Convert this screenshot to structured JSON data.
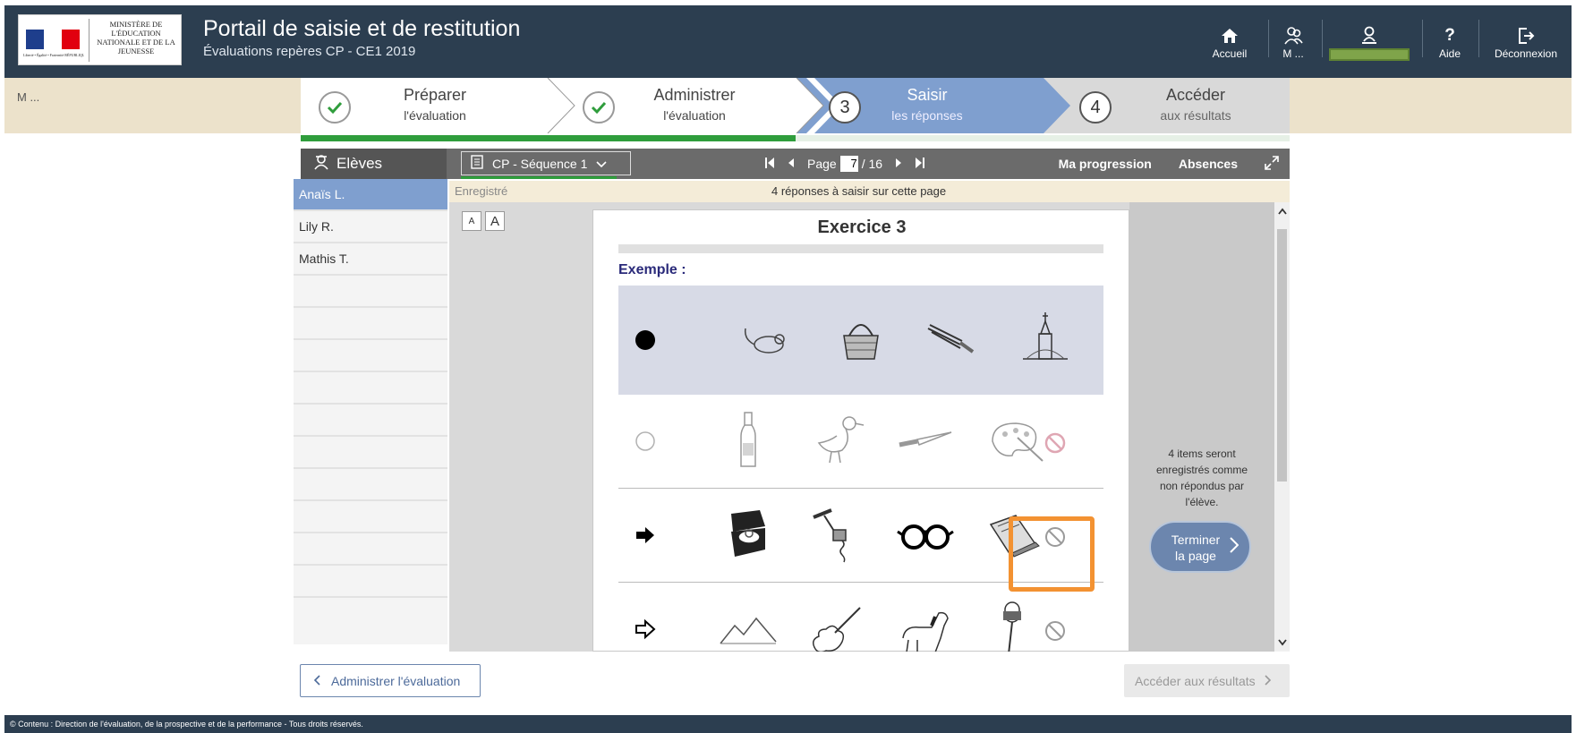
{
  "header": {
    "logo_text": "MINISTÈRE DE L'ÉDUCATION NATIONALE ET DE LA JEUNESSE",
    "logo_caption": "Liberté • Égalité • Fraternité RÉPUBLIQUE FRANÇAISE",
    "title": "Portail de saisie et de restitution",
    "subtitle": "Évaluations repères CP - CE1 2019",
    "nav": {
      "home": "Accueil",
      "school": "M ...",
      "help": "Aide",
      "logout": "Déconnexion"
    }
  },
  "band": {
    "user": "M ..."
  },
  "steps": [
    {
      "number": "1",
      "line1": "Préparer",
      "line2": "l'évaluation",
      "state": "done"
    },
    {
      "number": "2",
      "line1": "Administrer",
      "line2": "l'évaluation",
      "state": "done"
    },
    {
      "number": "3",
      "line1": "Saisir",
      "line2": "les réponses",
      "state": "active"
    },
    {
      "number": "4",
      "line1": "Accéder",
      "line2": "aux résultats",
      "state": "todo"
    }
  ],
  "steps_progress": 0.5,
  "toolbar": {
    "students_label": "Elèves",
    "sequence": "CP - Séquence 1",
    "page_label": "Page",
    "page_current": "7",
    "page_total": "/ 16",
    "progress_link": "Ma progression",
    "absences_link": "Absences"
  },
  "students": [
    {
      "name": "Anaïs L.",
      "active": true
    },
    {
      "name": "Lily R.",
      "active": false
    },
    {
      "name": "Mathis T.",
      "active": false
    },
    {
      "name": ""
    },
    {
      "name": ""
    },
    {
      "name": ""
    },
    {
      "name": ""
    },
    {
      "name": ""
    },
    {
      "name": ""
    },
    {
      "name": ""
    },
    {
      "name": ""
    },
    {
      "name": ""
    },
    {
      "name": ""
    }
  ],
  "infobar": {
    "saved": "Enregistré",
    "count": "4 réponses à saisir sur cette page"
  },
  "font_buttons": {
    "small": "A",
    "large": "A"
  },
  "exercise": {
    "title": "Exercice 3",
    "example_label": "Exemple :",
    "rows": [
      {
        "marker": "filled-dot",
        "pictures": [
          "mouse-icon",
          "basket-icon",
          "leek-icon",
          "church-icon"
        ]
      },
      {
        "marker": "circle-outline",
        "pictures": [
          "bottle-icon",
          "duck-icon",
          "knife-icon",
          "palette-icon"
        ]
      },
      {
        "marker": "arrow-filled",
        "pictures": [
          "ring-box-icon",
          "corkscrew-icon",
          "glasses-icon",
          "notebook-icon"
        ]
      },
      {
        "marker": "arrow-outline",
        "pictures": [
          "mountains-icon",
          "violin-icon",
          "horse-icon",
          "microphone-icon"
        ]
      }
    ]
  },
  "side_panel": {
    "message": "4 items seront enregistrés comme non répondus par l'élève.",
    "finish_button": "Terminer la page"
  },
  "bottom": {
    "back_button": "Administrer l'évaluation",
    "next_button": "Accéder aux résultats"
  },
  "footer": "© Contenu : Direction de l'évaluation, de la prospective et de la performance - Tous droits réservés.",
  "colors": {
    "header": "#2c3e50",
    "band": "#ece2cb",
    "active_step": "#7f9fcf",
    "done_check": "#2f9d3c",
    "highlight": "#f39232",
    "no_answer": "#c0506a"
  }
}
